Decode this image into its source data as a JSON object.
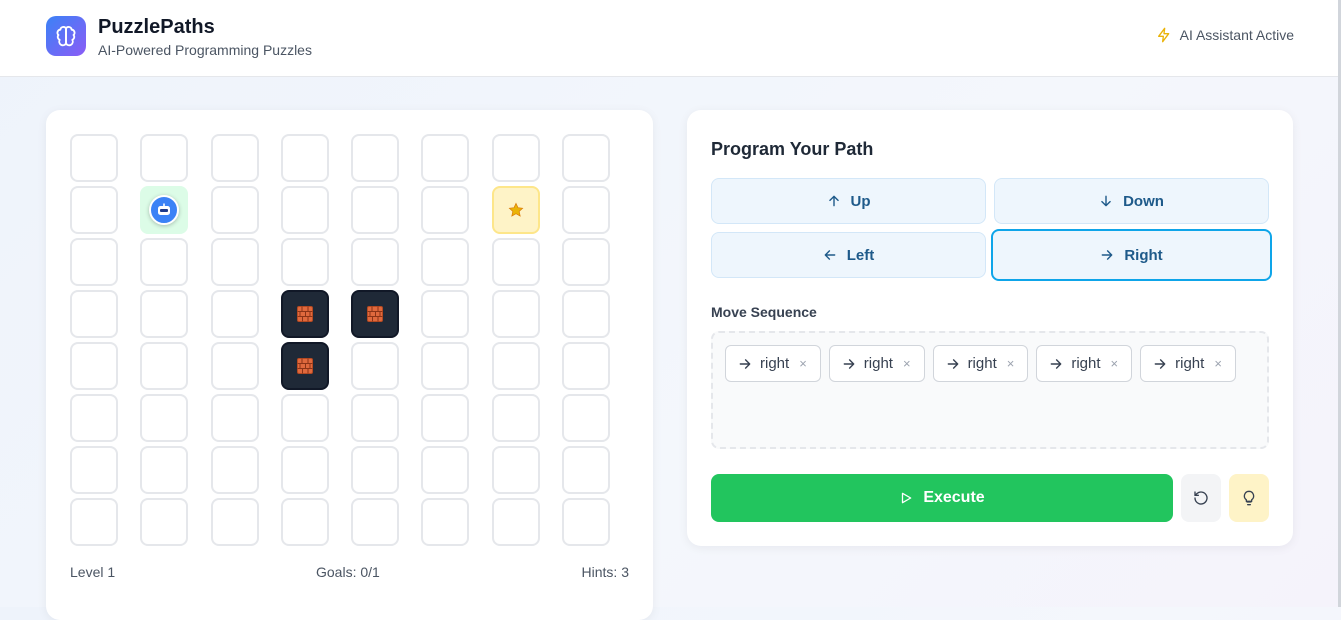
{
  "header": {
    "title": "PuzzlePaths",
    "subtitle": "AI-Powered Programming Puzzles",
    "logo_icon": "brain-icon",
    "status_icon": "lightning-icon",
    "status_text": "AI Assistant Active",
    "accent": "#3b82f6"
  },
  "board": {
    "rows": 8,
    "cols": 8,
    "player": [
      1,
      1
    ],
    "goal": [
      1,
      6
    ],
    "walls": [
      [
        3,
        3
      ],
      [
        3,
        4
      ],
      [
        4,
        3
      ]
    ],
    "player_icon": "robot-icon",
    "goal_icon": "star-icon",
    "wall_icon": "brick-icon",
    "footer": {
      "level": "Level 1",
      "goals": "Goals: 0/1",
      "hints": "Hints: 3"
    }
  },
  "program": {
    "title": "Program Your Path",
    "buttons": {
      "up": "Up",
      "down": "Down",
      "left": "Left",
      "right": "Right"
    },
    "selected_direction": "right",
    "sequence_label": "Move Sequence",
    "sequence": [
      "right",
      "right",
      "right",
      "right",
      "right"
    ],
    "remove_symbol": "×",
    "execute": "Execute",
    "colors": {
      "execute": "#22c55e",
      "hint": "#fef3c7",
      "reset": "#f3f4f6"
    }
  }
}
